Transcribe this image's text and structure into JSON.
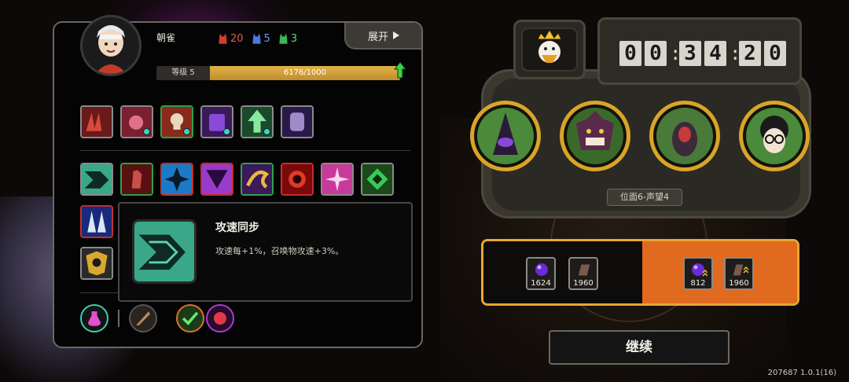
{
  "player": {
    "name": "朝雀",
    "stats": [
      {
        "icon": "red-demon-icon",
        "value": "20",
        "color": "#d83a32"
      },
      {
        "icon": "blue-demon-icon",
        "value": "5",
        "color": "#4a7ae0"
      },
      {
        "icon": "green-demon-icon",
        "value": "3",
        "color": "#3ab85a"
      }
    ],
    "expand_label": "展开",
    "level_label": "等级 5",
    "xp_text": "6176/1000",
    "xp_fraction": 1.0
  },
  "tooltip": {
    "title": "攻速同步",
    "description": "攻速每+1%，召唤物攻速+3%。"
  },
  "machine": {
    "timer": [
      "0",
      "0",
      "3",
      "4",
      "2",
      "0"
    ],
    "stage_label": "位面6-声望4"
  },
  "rewards": {
    "option_a": [
      {
        "icon": "purple-orb-icon",
        "value": "1624"
      },
      {
        "icon": "tablet-icon",
        "value": "1960"
      }
    ],
    "option_b": [
      {
        "icon": "purple-orb-upgrade-icon",
        "value": "812"
      },
      {
        "icon": "tablet-upgrade-icon",
        "value": "1960"
      }
    ]
  },
  "continue_label": "继续",
  "version": "207687 1.0.1(16)"
}
